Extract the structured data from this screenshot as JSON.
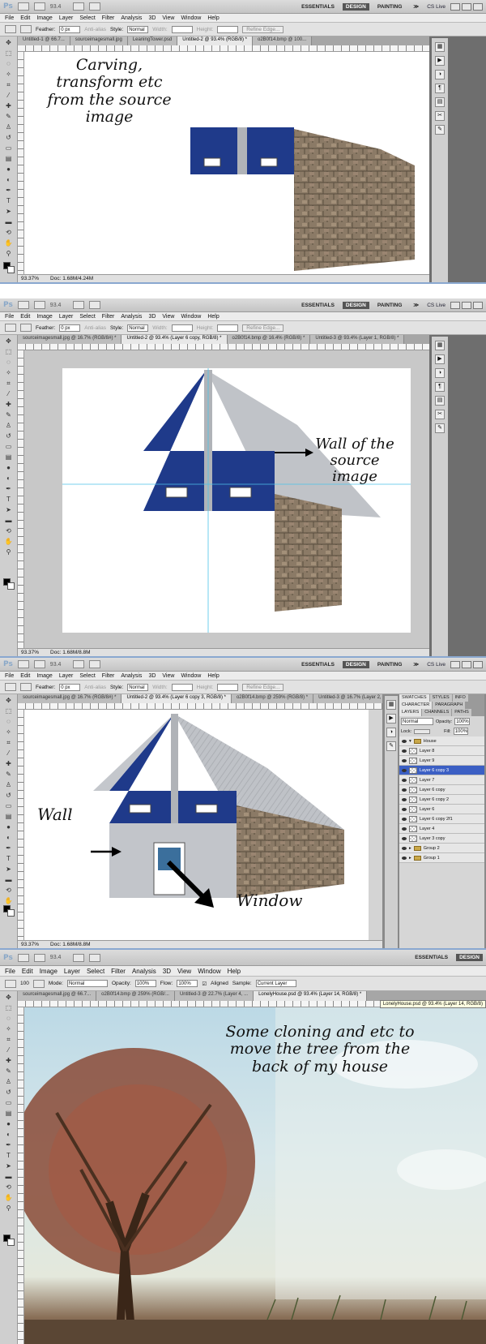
{
  "app": {
    "logo": "Ps",
    "workspaces": [
      "ESSENTIALS",
      "DESIGN",
      "PAINTING"
    ],
    "active_workspace": "DESIGN",
    "more": "≫",
    "cs_live": "CS Live"
  },
  "panels": [
    {
      "zoom": "93.4",
      "menu": [
        "File",
        "Edit",
        "Image",
        "Layer",
        "Select",
        "Filter",
        "Analysis",
        "3D",
        "View",
        "Window",
        "Help"
      ],
      "options": {
        "feather_label": "Feather:",
        "feather_value": "0 px",
        "antialias": "Anti-alias",
        "style_label": "Style:",
        "style_value": "Normal",
        "width_label": "Width:",
        "height_label": "Height:",
        "refine": "Refine Edge..."
      },
      "tabs": [
        "Untitled-1 @ 66.7...",
        "sourceimagesmall.jpg",
        "LeaningTower.psd",
        "Untitled-2 @ 93.4% (RGB/8) *",
        "o2B0f14.bmp @ 100..."
      ],
      "active_tab": 3,
      "caption": [
        "Carving,",
        "transform etc",
        "from the source",
        "image"
      ],
      "status_zoom": "93.37%",
      "status_doc": "Doc: 1.68M/4.24M"
    },
    {
      "zoom": "93.4",
      "menu": [
        "File",
        "Edit",
        "Image",
        "Layer",
        "Select",
        "Filter",
        "Analysis",
        "3D",
        "View",
        "Window",
        "Help"
      ],
      "options": {
        "feather_label": "Feather:",
        "feather_value": "0 px",
        "antialias": "Anti-alias",
        "style_label": "Style:",
        "style_value": "Normal",
        "width_label": "Width:",
        "height_label": "Height:",
        "refine": "Refine Edge..."
      },
      "tabs": [
        "sourceimagesmall.jpg @ 16.7% (RGB/8#) *",
        "Untitled-2 @ 93.4% (Layer 6 copy, RGB/8) *",
        "o2B0f14.bmp @ 16.4% (RGB/8) *",
        "Untitled-3 @ 93.4% (Layer 1, RGB/8) *"
      ],
      "active_tab": 1,
      "caption": [
        "Wall of the",
        "source",
        "image"
      ],
      "status_zoom": "93.37%",
      "status_doc": "Doc: 1.68M/8.8M"
    },
    {
      "zoom": "93.4",
      "menu": [
        "File",
        "Edit",
        "Image",
        "Layer",
        "Select",
        "Filter",
        "Analysis",
        "3D",
        "View",
        "Window",
        "Help"
      ],
      "options": {
        "feather_label": "Feather:",
        "feather_value": "0 px",
        "antialias": "Anti-alias",
        "style_label": "Style:",
        "style_value": "Normal",
        "width_label": "Width:",
        "height_label": "Height:",
        "refine": "Refine Edge..."
      },
      "tabs": [
        "sourceimagesmall.jpg @ 16.7% (RGB/8#) *",
        "Untitled-2 @ 93.4% (Layer 6 copy 3, RGB/8) *",
        "o2B0f14.bmp @ 259% (RGB/8) *",
        "Untitled-3 @ 16.7% (Layer 2, ..."
      ],
      "active_tab": 1,
      "caption_wall": "Wall",
      "caption_window": "Window",
      "status_zoom": "93.37%",
      "status_doc": "Doc: 1.68M/8.8M",
      "layers_panel": {
        "top_tabs": [
          "SWATCHES",
          "STYLES",
          "INFO"
        ],
        "mid_tabs": [
          "CHARACTER",
          "PARAGRAPH"
        ],
        "tabs": [
          "LAYERS",
          "CHANNELS",
          "PATHS"
        ],
        "blend": "Normal",
        "opacity_label": "Opacity:",
        "opacity": "100%",
        "lock_label": "Lock:",
        "fill_label": "Fill:",
        "fill": "100%",
        "group": "House",
        "layers": [
          "Layer 8",
          "Layer 9",
          "Layer 6 copy 3",
          "Layer 7",
          "Layer 6 copy",
          "Layer 6 copy 2",
          "Layer 6",
          "Layer 6 copy 2f1",
          "Layer 4",
          "Layer 3 copy"
        ],
        "selected": 2,
        "groups": [
          "Group 2",
          "Group 1"
        ]
      }
    },
    {
      "zoom": "93.4",
      "menu": [
        "File",
        "Edit",
        "Image",
        "Layer",
        "Select",
        "Filter",
        "Analysis",
        "3D",
        "View",
        "Window",
        "Help"
      ],
      "clone": {
        "mode_label": "Mode:",
        "mode": "Normal",
        "opacity_label": "Opacity:",
        "opacity": "100%",
        "flow_label": "Flow:",
        "flow": "100%",
        "aligned": "Aligned",
        "sample_label": "Sample:",
        "sample": "Current Layer",
        "brush_size": "100"
      },
      "tabs": [
        "sourceimagesmall.jpg @ 66.7...",
        "o2B0f14.bmp @ 259% (RGB/...",
        "Untitled-3 @ 22.7% (Layer 4, ...",
        "LonelyHouse.psd @ 93.4% (Layer 14, RGB/8) *"
      ],
      "active_tab": 3,
      "tooltip": "LonelyHouse.psd @ 93.4% (Layer 14, RGB/8)",
      "caption": [
        "Some cloning and etc to",
        "move the tree from the",
        "back of my house"
      ]
    }
  ],
  "colors": {
    "wall_blue": "#1f3a8a",
    "roof_grey": "#b8bcc2",
    "stone": "#8a7a66",
    "selection": "#3b5fc4"
  }
}
